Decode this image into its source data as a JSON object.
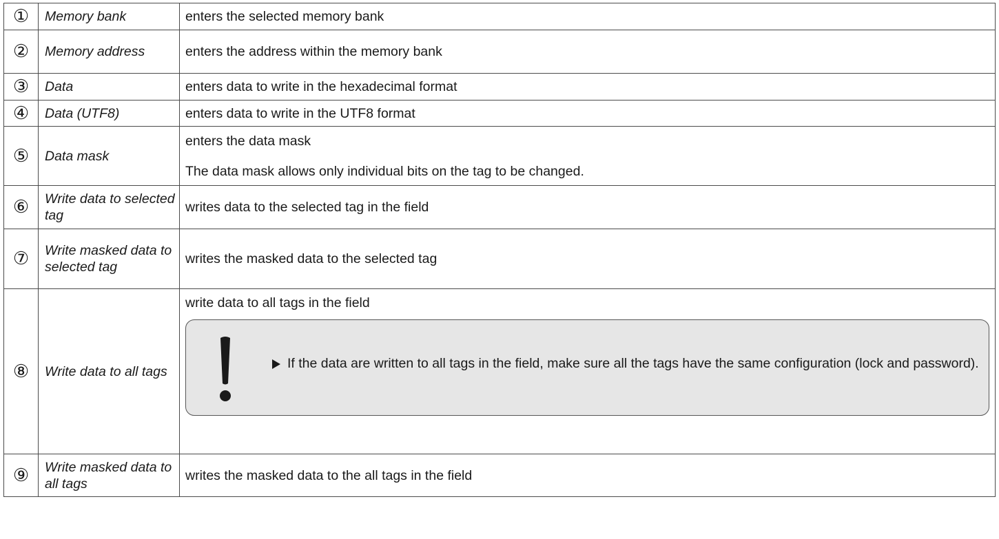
{
  "rows": [
    {
      "num": "①",
      "name": "Memory bank",
      "desc": "enters the selected memory bank"
    },
    {
      "num": "②",
      "name": "Memory address",
      "desc": "enters the address within the memory bank"
    },
    {
      "num": "③",
      "name": "Data",
      "desc": "enters data to write in the hexadecimal format"
    },
    {
      "num": "④",
      "name": "Data (UTF8)",
      "desc": "enters data to write in the UTF8 format"
    },
    {
      "num": "⑤",
      "name": "Data mask",
      "desc": "enters the data mask",
      "desc2": "The data mask allows only individual bits on the tag to be changed."
    },
    {
      "num": "⑥",
      "name": "Write data to selected tag",
      "desc": "writes data to the selected tag in the field"
    },
    {
      "num": "⑦",
      "name": "Write masked data to selected tag",
      "desc": "writes the masked data to the selected tag"
    },
    {
      "num": "⑧",
      "name": "Write data to all tags",
      "desc": "write data to all tags in the field",
      "note": {
        "icon": "exclamation-icon",
        "text": "If the data are written to all tags in the field, make sure all the tags have the same configuration (lock and password)."
      }
    },
    {
      "num": "⑨",
      "name": "Write masked data to all tags",
      "desc": "writes the masked data to the all tags in the field"
    }
  ]
}
